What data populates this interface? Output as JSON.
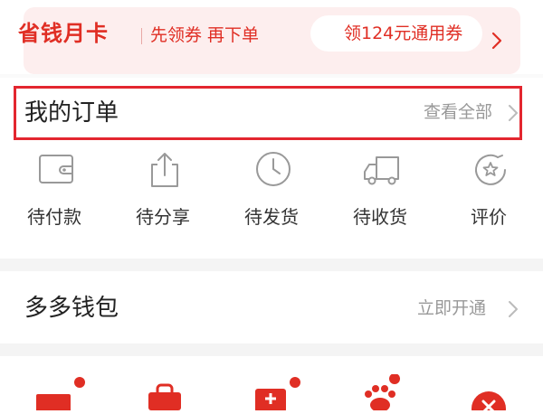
{
  "promo": {
    "title": "省钱月卡",
    "subtitle": "先领券 再下单",
    "coupon_label": "领124元通用券"
  },
  "orders": {
    "title": "我的订单",
    "view_all": "查看全部",
    "items": [
      {
        "label": "待付款",
        "icon": "wallet-icon"
      },
      {
        "label": "待分享",
        "icon": "share-icon"
      },
      {
        "label": "待发货",
        "icon": "clock-icon"
      },
      {
        "label": "待收货",
        "icon": "truck-icon"
      },
      {
        "label": "评价",
        "icon": "review-icon"
      }
    ]
  },
  "wallet": {
    "title": "多多钱包",
    "action": "立即开通"
  },
  "shortcuts": [
    {
      "icon": "ticket-icon",
      "badge": true
    },
    {
      "icon": "bag-icon",
      "badge": false
    },
    {
      "icon": "medical-icon",
      "badge": true
    },
    {
      "icon": "paw-icon",
      "badge": true
    },
    {
      "icon": "close-circle-icon",
      "badge": false
    }
  ],
  "colors": {
    "accent": "#e02e24",
    "promo_bg": "#fdeeee",
    "highlight_border": "#e3262f",
    "muted_text": "#999999",
    "separator": "#f4f4f4"
  }
}
